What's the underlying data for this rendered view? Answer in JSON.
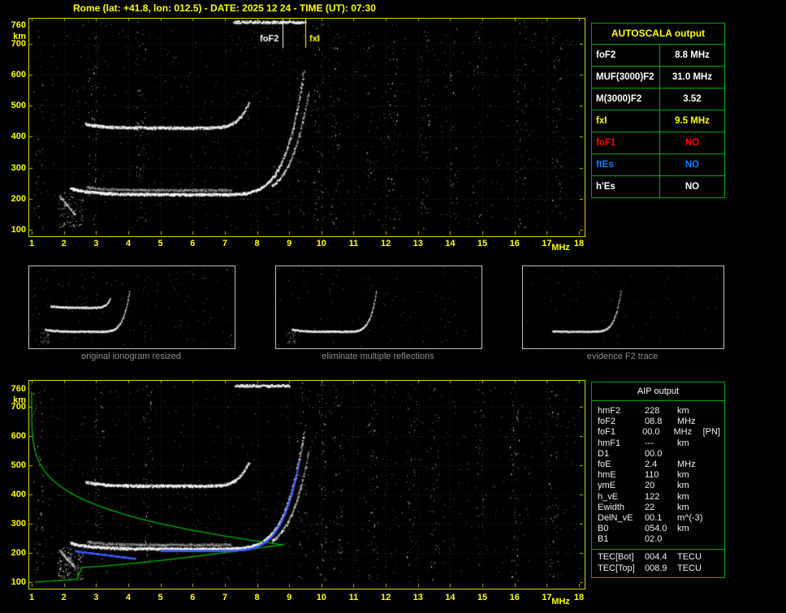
{
  "header": {
    "title": "Rome (lat: +41.8, lon: 012.5) - DATE: 2025 12 24 - TIME (UT): 07:30"
  },
  "plot_axes": {
    "y_unit": "km",
    "y_ticks": [
      "760",
      "700",
      "600",
      "500",
      "400",
      "300",
      "200",
      "100"
    ],
    "x_unit": "MHz",
    "x_ticks": [
      "1",
      "2",
      "3",
      "4",
      "5",
      "6",
      "7",
      "8",
      "9",
      "10",
      "11",
      "12",
      "13",
      "14",
      "15",
      "16",
      "17",
      "18"
    ],
    "x_range_mhz": [
      1,
      18
    ],
    "y_range_km": [
      100,
      760
    ]
  },
  "markers": {
    "foF2": {
      "label": "foF2",
      "freq_mhz": 8.8,
      "color": "#ffffff"
    },
    "fxI": {
      "label": "fxI",
      "freq_mhz": 9.5,
      "color": "#ffff00"
    }
  },
  "autoscala": {
    "title": "AUTOSCALA output",
    "rows": [
      {
        "label": "foF2",
        "value": "8.8 MHz",
        "color": "#ffffff"
      },
      {
        "label": "MUF(3000)F2",
        "value": "31.0 MHz",
        "color": "#ffffff"
      },
      {
        "label": "M(3000)F2",
        "value": "3.52",
        "color": "#ffffff"
      },
      {
        "label": "fxI",
        "value": "9.5 MHz",
        "color": "#ffff00"
      },
      {
        "label": "foF1",
        "value": "NO",
        "color": "#ff0000"
      },
      {
        "label": "ftEs",
        "value": "NO",
        "color": "#0080ff"
      },
      {
        "label": "h'Es",
        "value": "NO",
        "color": "#ffffff"
      }
    ]
  },
  "panels": {
    "captions": [
      "original ionogram resized",
      "eliminate multiple reflections",
      "evidence F2 trace"
    ]
  },
  "aip": {
    "title": "AIP output",
    "rows": [
      {
        "label": "hmF2",
        "value": "228",
        "unit": "km",
        "note": ""
      },
      {
        "label": "foF2",
        "value": "08.8",
        "unit": "MHz",
        "note": ""
      },
      {
        "label": "foF1",
        "value": "00.0",
        "unit": "MHz",
        "note": "[PN]"
      },
      {
        "label": "hmF1",
        "value": "---",
        "unit": "km",
        "note": ""
      },
      {
        "label": "D1",
        "value": "00.0",
        "unit": "",
        "note": ""
      },
      {
        "label": "foE",
        "value": "2.4",
        "unit": "MHz",
        "note": ""
      },
      {
        "label": "hmE",
        "value": "110",
        "unit": "km",
        "note": ""
      },
      {
        "label": "ymE",
        "value": "20",
        "unit": "km",
        "note": ""
      },
      {
        "label": "h_vE",
        "value": "122",
        "unit": "km",
        "note": ""
      },
      {
        "label": "Ewidth",
        "value": "22",
        "unit": "km",
        "note": ""
      },
      {
        "label": "DelN_vE",
        "value": "00.1",
        "unit": "m^(-3)",
        "note": ""
      },
      {
        "label": "B0",
        "value": "054.0",
        "unit": "km",
        "note": ""
      },
      {
        "label": "B1",
        "value": "02.0",
        "unit": "",
        "note": ""
      }
    ],
    "tec_rows": [
      {
        "label": "TEC[Bot]",
        "value": "004.4",
        "unit": "TECU"
      },
      {
        "label": "TEC[Top]",
        "value": "008.9",
        "unit": "TECU"
      }
    ]
  },
  "colors": {
    "accent_yellow": "#ffff00",
    "table_green": "#00aa00",
    "profile_green": "#00b400",
    "fit_blue": "#3b5bff"
  }
}
